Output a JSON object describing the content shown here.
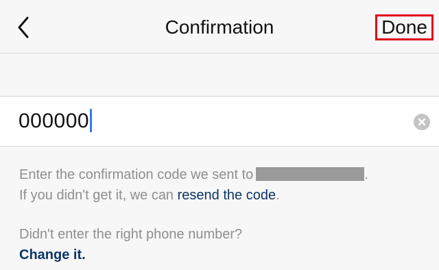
{
  "nav": {
    "title": "Confirmation",
    "done_label": "Done",
    "back_icon": "chevron-left-icon"
  },
  "code_input": {
    "value": "000000",
    "clear_icon": "clear-circle-icon"
  },
  "info": {
    "line1_prefix": "Enter the confirmation code we sent to",
    "line1_suffix": ".",
    "line2_prefix": "If you didn't get it, we can",
    "resend_link": "resend the code",
    "line2_suffix": "."
  },
  "phone": {
    "question": "Didn't enter the right phone number?",
    "change_link": "Change it."
  },
  "colors": {
    "link": "#0b3466",
    "done_highlight": "#e0001a",
    "caret": "#3478f6"
  }
}
